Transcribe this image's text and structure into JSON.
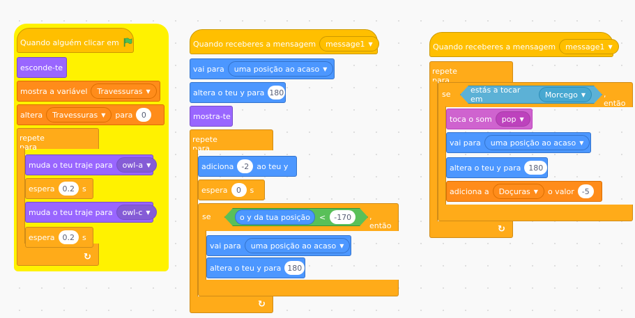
{
  "script1": {
    "hat_label": "Quando alguém clicar em",
    "hide": "esconde-te",
    "show_var": "mostra a variável",
    "show_var_name": "Travessuras",
    "set_label": "altera",
    "set_var": "Travessuras",
    "set_to": "para",
    "set_value": "0",
    "forever": "repete para sempre",
    "costume1_label": "muda o teu traje para",
    "costume1_value": "owl-a",
    "wait1_label": "espera",
    "wait1_value": "0.2",
    "wait1_unit": "s",
    "costume2_label": "muda o teu traje para",
    "costume2_value": "owl-c",
    "wait2_label": "espera",
    "wait2_value": "0.2",
    "wait2_unit": "s"
  },
  "script2": {
    "hat_label": "Quando receberes a mensagem",
    "message": "message1",
    "goto_label": "vai para",
    "goto_value": "uma posição ao acaso",
    "sety_label": "altera o teu y para",
    "sety_value": "180",
    "show": "mostra-te",
    "forever": "repete para sempre",
    "change_label": "adiciona",
    "change_value": "-2",
    "change_suffix": "ao teu y",
    "wait_label": "espera",
    "wait_value": "0",
    "wait_unit": "s",
    "if_label": "se",
    "cond_reporter": "o y da tua posição",
    "cond_op": "<",
    "cond_value": "-170",
    "then_label": ", então",
    "goto2_label": "vai para",
    "goto2_value": "uma posição ao acaso",
    "sety2_label": "altera o teu y para",
    "sety2_value": "180"
  },
  "script3": {
    "hat_label": "Quando receberes a mensagem",
    "message": "message1",
    "forever": "repete para sempre",
    "if_label": "se",
    "touch_label": "estás a tocar em",
    "touch_value": "Morcego",
    "then_label": ", então",
    "sound_label": "toca o som",
    "sound_value": "pop",
    "goto_label": "vai para",
    "goto_value": "uma posição ao acaso",
    "sety_label": "altera o teu y para",
    "sety_value": "180",
    "addvar_label": "adiciona a",
    "addvar_name": "Doçuras",
    "addvar_mid": "o valor",
    "addvar_value": "-5"
  },
  "colors": {
    "events": "#ffbf00",
    "control": "#ffab19",
    "looks": "#9966ff",
    "motion": "#4c97ff",
    "variables": "#ff8c1a",
    "sound": "#cf63cf",
    "sensing": "#5cb1d6",
    "operators": "#59c059",
    "highlight": "#fff200"
  }
}
